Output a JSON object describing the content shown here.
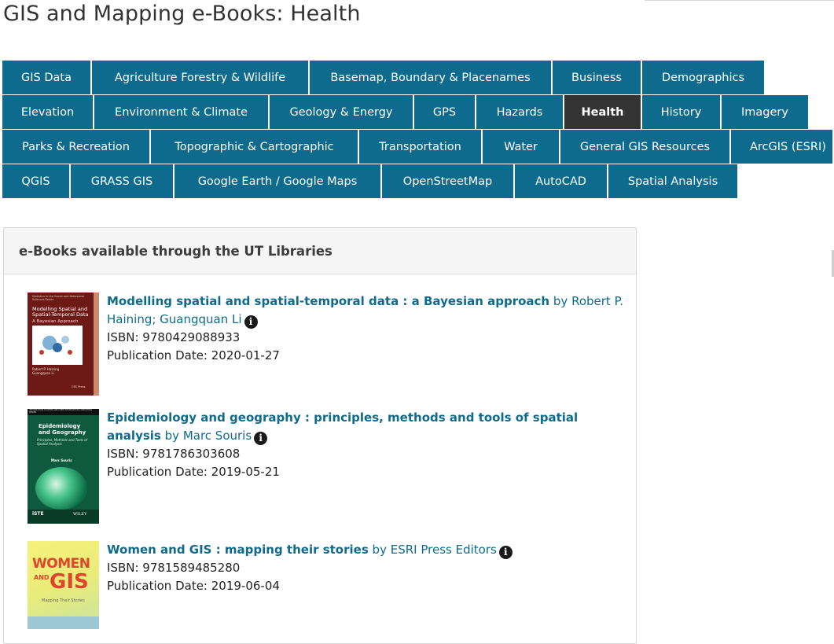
{
  "page": {
    "title": "GIS and Mapping e-Books: Health"
  },
  "tabs": {
    "rows": [
      [
        {
          "label": "GIS Data"
        },
        {
          "label": "Agriculture Forestry & Wildlife"
        },
        {
          "label": "Basemap, Boundary & Placenames"
        },
        {
          "label": "Business"
        },
        {
          "label": "Demographics"
        }
      ],
      [
        {
          "label": "Elevation"
        },
        {
          "label": "Environment & Climate"
        },
        {
          "label": "Geology & Energy"
        },
        {
          "label": "GPS"
        },
        {
          "label": "Hazards"
        },
        {
          "label": "Health",
          "active": true
        },
        {
          "label": "History"
        },
        {
          "label": "Imagery"
        }
      ],
      [
        {
          "label": "Parks & Recreation"
        },
        {
          "label": "Topographic & Cartographic"
        },
        {
          "label": "Transportation"
        },
        {
          "label": "Water"
        },
        {
          "label": "General GIS Resources"
        },
        {
          "label": "ArcGIS (ESRI)"
        }
      ],
      [
        {
          "label": "QGIS"
        },
        {
          "label": "GRASS GIS"
        },
        {
          "label": "Google Earth / Google Maps"
        },
        {
          "label": "OpenStreetMap"
        },
        {
          "label": "AutoCAD"
        },
        {
          "label": "Spatial Analysis"
        }
      ]
    ]
  },
  "panel": {
    "heading": "e-Books available through the UT Libraries",
    "books": [
      {
        "title": "Modelling spatial and spatial-temporal data : a Bayesian approach",
        "by": "by",
        "author": "Robert P. Haining; Guangquan Li",
        "isbn": "ISBN: 9780429088933",
        "pub_date": "Publication Date: 2020-01-27",
        "cover": {
          "series": "Statistics in the Social and Behavioral Sciences Series",
          "title": "Modelling Spatial and Spatial-Temporal Data",
          "subtitle": "A Bayesian Approach",
          "authors": "Robert P. Haining Guangquan Li",
          "publisher": "CRC Press"
        }
      },
      {
        "title": "Epidemiology and geography : principles, methods and tools of spatial analysis",
        "by": "by",
        "author": "Marc Souris",
        "isbn": "ISBN: 9781786303608",
        "pub_date": "Publication Date: 2019-05-21",
        "cover": {
          "series": "INFORMATION SYSTEMS AND WEB INFORMATION COMPUTING SERIES",
          "title": "Epidemiology and Geography",
          "subtitle": "Principles, Methods and Tools of Spatial Analysis",
          "authors": "Marc Souris",
          "publisher_left": "iSTE",
          "publisher_right": "WILEY"
        }
      },
      {
        "title": "Women and GIS : mapping their stories",
        "by": "by",
        "author": "ESRI Press Editors",
        "isbn": "ISBN: 9781589485280",
        "pub_date": "Publication Date: 2019-06-04",
        "cover": {
          "word1": "WOMEN",
          "word2": "AND",
          "word3": "GIS",
          "subtitle": "Mapping Their Stories"
        }
      }
    ]
  },
  "colors": {
    "tab_bg": "#0e6b8e",
    "tab_active_bg": "#333333",
    "link": "#0e6b8e"
  },
  "icons": {
    "info": "info-circle-icon"
  }
}
